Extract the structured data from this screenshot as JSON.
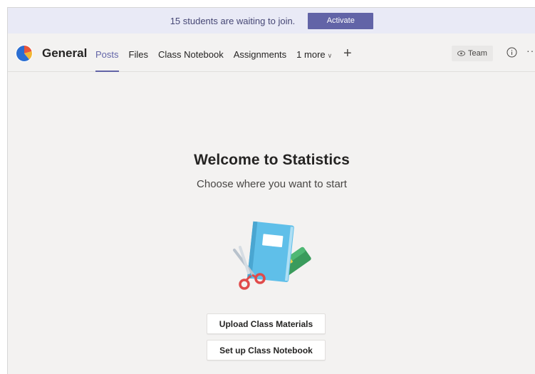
{
  "banner": {
    "message": "15 students are waiting to join.",
    "activate_label": "Activate"
  },
  "header": {
    "channel_name": "General",
    "tabs": [
      {
        "label": "Posts",
        "active": true
      },
      {
        "label": "Files",
        "active": false
      },
      {
        "label": "Class Notebook",
        "active": false
      },
      {
        "label": "Assignments",
        "active": false
      },
      {
        "label": "1 more",
        "active": false
      }
    ],
    "team_label": "Team",
    "icons": {
      "avatar": "team-pie-avatar-icon",
      "add_tab": "plus-icon",
      "team": "eye-icon",
      "info": "info-icon",
      "more": "ellipsis-icon"
    }
  },
  "main": {
    "title": "Welcome to Statistics",
    "subtitle": "Choose where you want to start",
    "illustration": "notebook-scissors-pencils-illustration",
    "buttons": {
      "upload": "Upload Class Materials",
      "notebook": "Set up Class Notebook"
    }
  },
  "colors": {
    "accent": "#6264a7",
    "banner_bg": "#e9eaf6",
    "page_bg": "#f3f2f1"
  }
}
